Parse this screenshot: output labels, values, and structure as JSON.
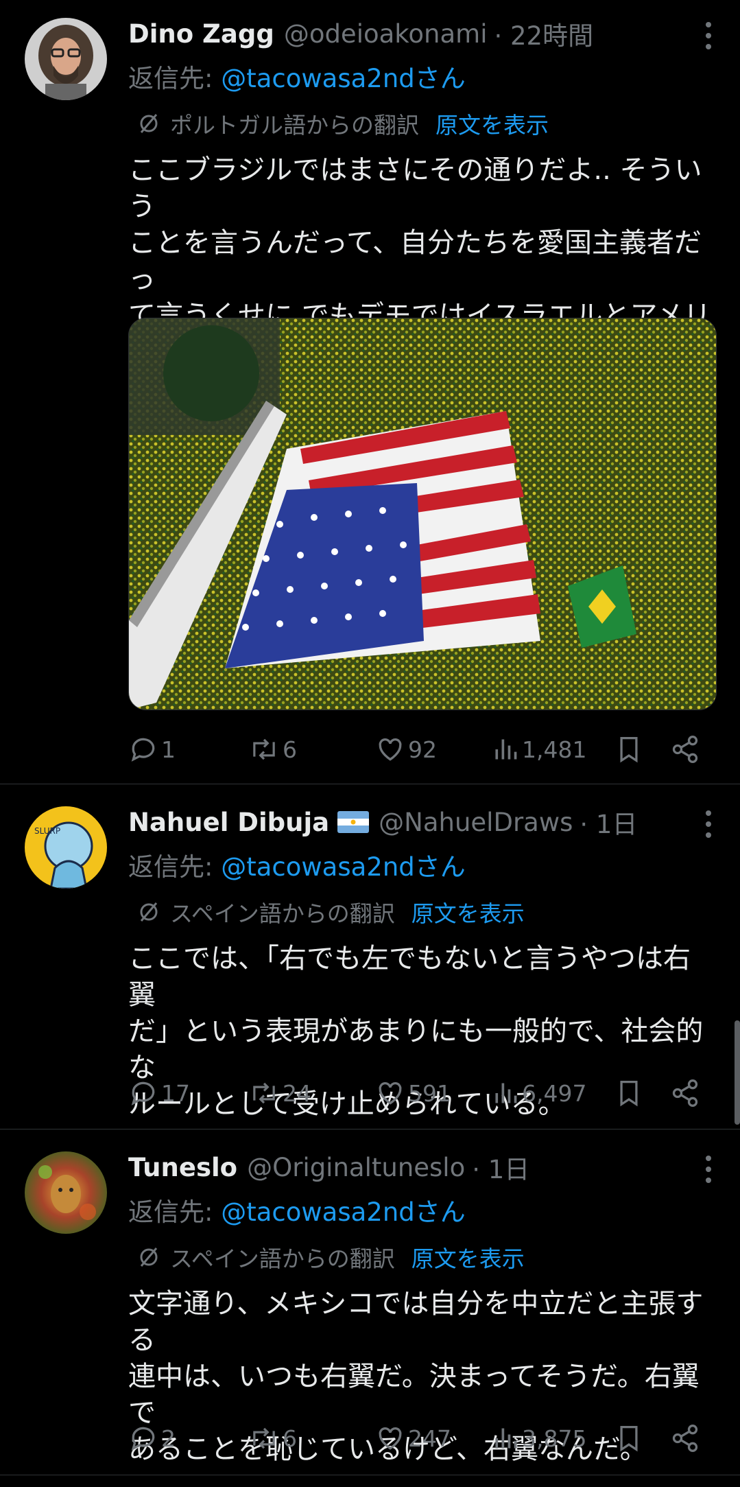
{
  "tweets": [
    {
      "name": "Dino Zagg",
      "handle": "@odeioakonami",
      "time": "· 22時間",
      "reply_prefix": "返信先: ",
      "reply_to": "@tacowasa2ndさん",
      "translation_label": "ポルトガル語からの翻訳",
      "show_original": "原文を表示",
      "text": "ここブラジルではまさにその通りだよ.. そういう\nことを言うんだって、自分たちを愛国主義者だっ\nて言うくせに でもデモではイスラエルとアメリカ\nの国旗に敬礼してるんだぜ。",
      "replies": "1",
      "reposts": "6",
      "likes": "92",
      "views": "1,481"
    },
    {
      "name": "Nahuel Dibuja",
      "handle": "@NahuelDraws",
      "time": "· 1日",
      "reply_prefix": "返信先: ",
      "reply_to": "@tacowasa2ndさん",
      "translation_label": "スペイン語からの翻訳",
      "show_original": "原文を表示",
      "text": "ここでは、「右でも左でもないと言うやつは右翼\nだ」という表現があまりにも一般的で、社会的な\nルールとして受け止められている。",
      "replies": "17",
      "reposts": "24",
      "likes": "591",
      "views": "6,497"
    },
    {
      "name": "Tuneslo",
      "handle": "@Originaltuneslo",
      "time": "· 1日",
      "reply_prefix": "返信先: ",
      "reply_to": "@tacowasa2ndさん",
      "translation_label": "スペイン語からの翻訳",
      "show_original": "原文を表示",
      "text": "文字通り、メキシコでは自分を中立だと主張する\n連中は、いつも右翼だ。決まってそうだ。右翼で\nあることを恥じているけど、右翼なんだ。",
      "replies": "2",
      "reposts": "6",
      "likes": "247",
      "views": "3,875"
    }
  ],
  "colors": {
    "background": "#000000",
    "text": "#e7e9ea",
    "muted": "#71767b",
    "link": "#1d9bf0",
    "divider": "#2f3336"
  },
  "icons": [
    "reply-icon",
    "repost-icon",
    "like-icon",
    "views-icon",
    "bookmark-icon",
    "share-icon",
    "translate-icon",
    "more-icon",
    "argentina-flag-icon"
  ]
}
